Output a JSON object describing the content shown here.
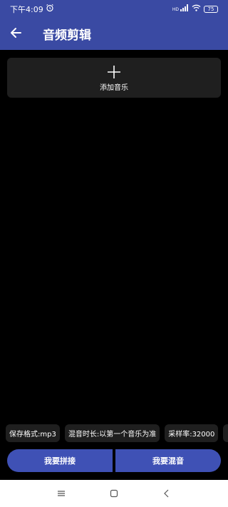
{
  "status_bar": {
    "time": "下午4:09",
    "battery": "75",
    "network": "HD"
  },
  "app_bar": {
    "title": "音频剪辑"
  },
  "add_music": {
    "label": "添加音乐"
  },
  "options": [
    "保存格式:mp3",
    "混音时长:以第一个音乐为准",
    "采样率:32000"
  ],
  "actions": {
    "concat_label": "我要拼接",
    "mix_label": "我要混音"
  },
  "colors": {
    "primary": "#3f51b5",
    "app_bar": "#3a4aa3",
    "background": "#000000",
    "card": "#1f1f1f"
  }
}
